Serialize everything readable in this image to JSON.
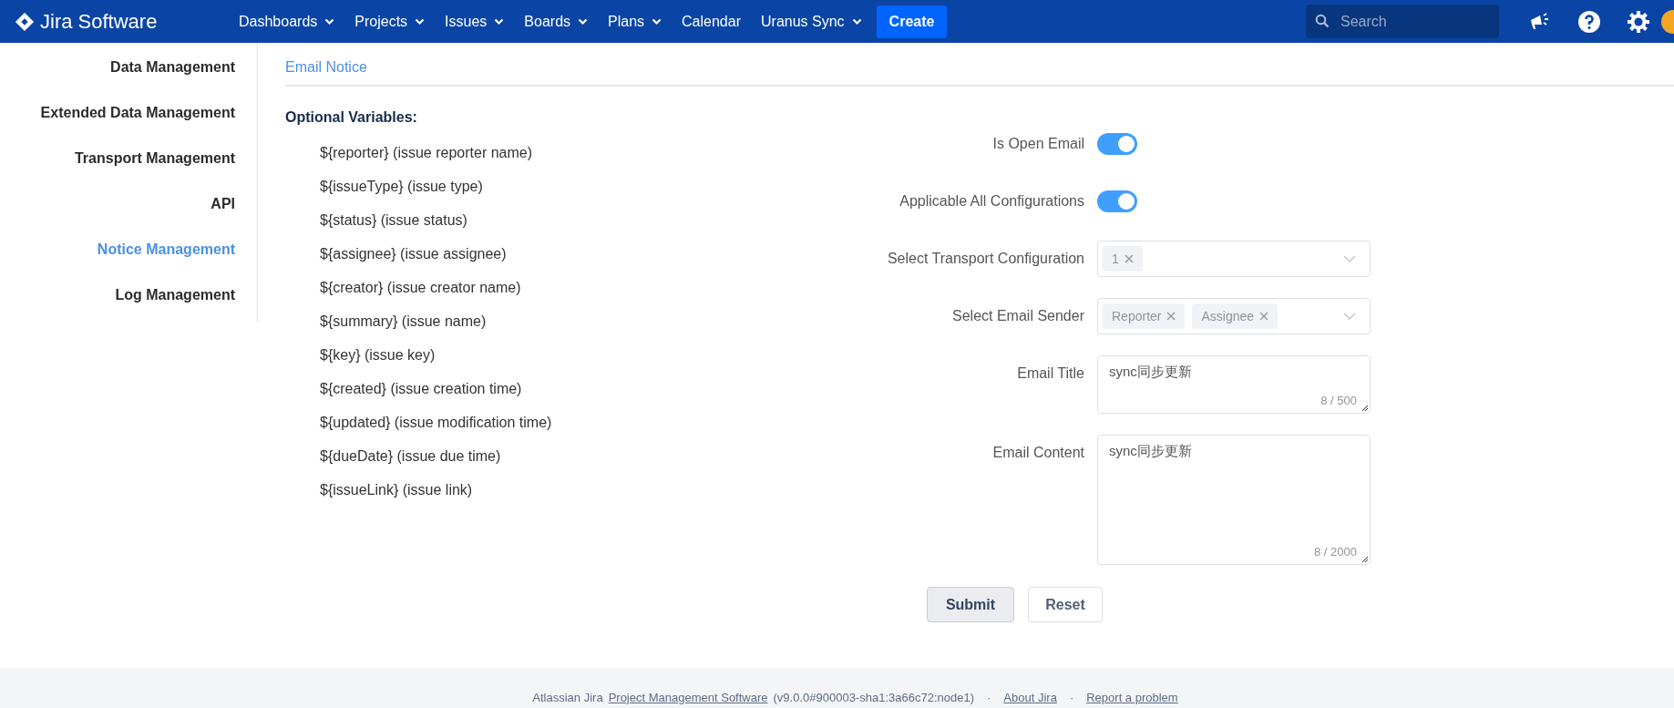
{
  "header": {
    "logo": "Jira Software",
    "nav": [
      {
        "label": "Dashboards",
        "dropdown": true
      },
      {
        "label": "Projects",
        "dropdown": true
      },
      {
        "label": "Issues",
        "dropdown": true
      },
      {
        "label": "Boards",
        "dropdown": true
      },
      {
        "label": "Plans",
        "dropdown": true
      },
      {
        "label": "Calendar",
        "dropdown": false
      },
      {
        "label": "Uranus Sync",
        "dropdown": true
      }
    ],
    "create": "Create",
    "search": {
      "placeholder": "Search"
    }
  },
  "sidebar": {
    "items": [
      {
        "label": "Data Management",
        "selected": false
      },
      {
        "label": "Extended Data Management",
        "selected": false
      },
      {
        "label": "Transport Management",
        "selected": false
      },
      {
        "label": "API",
        "selected": false
      },
      {
        "label": "Notice Management",
        "selected": true
      },
      {
        "label": "Log Management",
        "selected": false
      }
    ]
  },
  "tab": "Email Notice",
  "variables": {
    "title": "Optional Variables:",
    "items": [
      "${reporter} (issue reporter name)",
      "${issueType} (issue type)",
      "${status} (issue status)",
      "${assignee} (issue assignee)",
      "${creator} (issue creator name)",
      "${summary} (issue name)",
      "${key} (issue key)",
      "${created} (issue creation time)",
      "${updated} (issue modification time)",
      "${dueDate} (issue due time)",
      "${issueLink} (issue link)"
    ]
  },
  "form": {
    "fields": [
      {
        "kind": "toggle",
        "label": "Is Open Email",
        "on": true
      },
      {
        "kind": "toggle",
        "label": "Applicable All Configurations",
        "on": true
      },
      {
        "kind": "select",
        "label": "Select Transport Configuration",
        "tags": [
          "1"
        ]
      },
      {
        "kind": "select",
        "label": "Select Email Sender",
        "tags": [
          "Reporter",
          "Assignee"
        ]
      },
      {
        "kind": "short_text",
        "label": "Email Title",
        "value": "sync同步更新",
        "counter": "8 / 500"
      },
      {
        "kind": "long_text",
        "label": "Email Content",
        "value": "sync同步更新",
        "counter": "8 / 2000"
      }
    ],
    "buttons": [
      {
        "label": "Submit",
        "primary": true
      },
      {
        "label": "Reset",
        "primary": false
      }
    ]
  },
  "footer": [
    {
      "kind": "text",
      "text": "Atlassian Jira"
    },
    {
      "kind": "link",
      "text": "Project Management Software"
    },
    {
      "kind": "text",
      "text": "(v9.0.0#900003-sha1:3a66c72:node1)"
    },
    {
      "kind": "text",
      "text": "·"
    },
    {
      "kind": "link",
      "text": "About Jira"
    },
    {
      "kind": "text",
      "text": "·"
    },
    {
      "kind": "link",
      "text": "Report a problem"
    }
  ]
}
